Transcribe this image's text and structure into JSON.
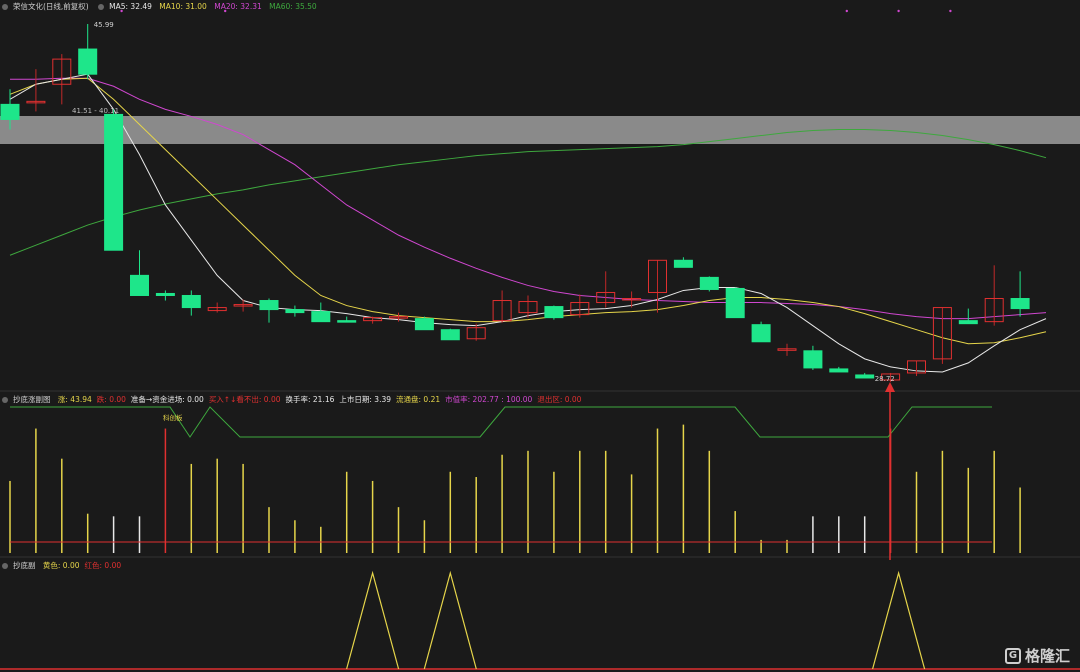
{
  "header": {
    "stock": "荣信文化(日线,前复权)",
    "ma5": "MA5: 32.49",
    "ma10": "MA10: 31.00",
    "ma20": "MA20: 32.31",
    "ma60": "MA60: 35.50",
    "colors": {
      "ma5": "#e8e8e8",
      "ma10": "#e6d54a",
      "ma20": "#d047d0",
      "ma60": "#3ea83e"
    }
  },
  "annotations": {
    "high": "45.99",
    "low": "28.72",
    "zone": "41.51 - 40.11",
    "board": "科创板"
  },
  "panel2": {
    "title": "抄底涨副图",
    "items": [
      "涨: 43.94",
      "跌: 0.00",
      "准备→资金进场: 0.00",
      "买入↑↓看不出: 0.00",
      "换手率: 21.16",
      "上市日期: 3.39",
      "流通盘: 0.21",
      "市值率: 202.77 : 100.00",
      "退出区: 0.00"
    ],
    "colors": [
      "#e6d54a",
      "#e03030",
      "#e8e8e8",
      "#e03030",
      "#e8e8e8",
      "#e8e8e8",
      "#e6d54a",
      "#d047d0",
      "#e03030"
    ]
  },
  "panel3": {
    "title": "抄底副",
    "items": [
      "黄色: 0.00",
      "红色: 0.00"
    ],
    "colors": [
      "#e6d54a",
      "#e03030"
    ]
  },
  "watermark": "格隆汇",
  "chart_data": {
    "type": "candlestick",
    "candles": [
      {
        "o": 38.0,
        "h": 39.5,
        "l": 35.5,
        "c": 36.5
      },
      {
        "o": 38.2,
        "h": 41.5,
        "l": 37.3,
        "c": 38.3
      },
      {
        "o": 40.0,
        "h": 43.0,
        "l": 38.0,
        "c": 42.5
      },
      {
        "o": 43.5,
        "h": 45.99,
        "l": 40.5,
        "c": 41.0
      },
      {
        "o": 37.0,
        "h": 37.5,
        "l": 23.5,
        "c": 23.5
      },
      {
        "o": 21.0,
        "h": 23.5,
        "l": 19.5,
        "c": 19.0
      },
      {
        "o": 19.2,
        "h": 19.5,
        "l": 18.5,
        "c": 19.0
      },
      {
        "o": 19.0,
        "h": 19.5,
        "l": 17.0,
        "c": 17.8
      },
      {
        "o": 17.5,
        "h": 18.3,
        "l": 17.3,
        "c": 17.8
      },
      {
        "o": 18.0,
        "h": 18.6,
        "l": 17.4,
        "c": 18.1
      },
      {
        "o": 18.5,
        "h": 18.7,
        "l": 16.3,
        "c": 17.6
      },
      {
        "o": 17.6,
        "h": 18.0,
        "l": 16.9,
        "c": 17.3
      },
      {
        "o": 17.4,
        "h": 18.3,
        "l": 16.4,
        "c": 16.4
      },
      {
        "o": 16.5,
        "h": 16.9,
        "l": 16.4,
        "c": 16.4
      },
      {
        "o": 16.5,
        "h": 16.9,
        "l": 16.2,
        "c": 16.8
      },
      {
        "o": 16.9,
        "h": 17.3,
        "l": 16.4,
        "c": 16.9
      },
      {
        "o": 16.7,
        "h": 16.9,
        "l": 15.8,
        "c": 15.6
      },
      {
        "o": 15.6,
        "h": 15.7,
        "l": 14.6,
        "c": 14.6
      },
      {
        "o": 14.7,
        "h": 16.2,
        "l": 14.5,
        "c": 15.8
      },
      {
        "o": 16.5,
        "h": 19.5,
        "l": 16.3,
        "c": 18.5
      },
      {
        "o": 17.3,
        "h": 19.0,
        "l": 16.8,
        "c": 18.4
      },
      {
        "o": 17.9,
        "h": 18.0,
        "l": 16.6,
        "c": 16.8
      },
      {
        "o": 17.1,
        "h": 19.1,
        "l": 16.8,
        "c": 18.3
      },
      {
        "o": 18.3,
        "h": 21.4,
        "l": 17.8,
        "c": 19.3
      },
      {
        "o": 18.6,
        "h": 19.4,
        "l": 17.8,
        "c": 18.7
      },
      {
        "o": 19.3,
        "h": 22.5,
        "l": 17.3,
        "c": 22.5
      },
      {
        "o": 22.5,
        "h": 22.8,
        "l": 21.8,
        "c": 21.8
      },
      {
        "o": 20.8,
        "h": 20.9,
        "l": 19.4,
        "c": 19.6
      },
      {
        "o": 19.7,
        "h": 19.8,
        "l": 16.8,
        "c": 16.8
      },
      {
        "o": 16.1,
        "h": 16.4,
        "l": 14.5,
        "c": 14.4
      },
      {
        "o": 13.7,
        "h": 14.2,
        "l": 13.0,
        "c": 13.7
      },
      {
        "o": 13.5,
        "h": 14.0,
        "l": 11.6,
        "c": 11.8
      },
      {
        "o": 11.7,
        "h": 11.9,
        "l": 11.4,
        "c": 11.4
      },
      {
        "o": 11.1,
        "h": 11.3,
        "l": 10.8,
        "c": 10.8
      },
      {
        "o": 10.6,
        "h": 11.3,
        "l": 10.4,
        "c": 11.2
      },
      {
        "o": 11.3,
        "h": 12.5,
        "l": 11.0,
        "c": 12.5
      },
      {
        "o": 12.7,
        "h": 17.8,
        "l": 12.2,
        "c": 17.8
      },
      {
        "o": 16.5,
        "h": 17.7,
        "l": 16.2,
        "c": 16.2
      },
      {
        "o": 16.4,
        "h": 22.0,
        "l": 16.0,
        "c": 18.7
      },
      {
        "o": 18.7,
        "h": 21.4,
        "l": 16.9,
        "c": 17.7
      }
    ],
    "price_levels": {
      "high": 45.99,
      "low": 28.72,
      "zone": [
        41.51,
        40.11
      ]
    },
    "ma5": [
      38.5,
      40,
      40.5,
      41,
      37.5,
      33,
      28,
      24.5,
      21,
      18.5,
      17.8,
      17.6,
      17.5,
      17.2,
      16.8,
      16.6,
      16.3,
      16.1,
      16,
      16.4,
      17,
      17.4,
      17.6,
      17.7,
      18,
      18.6,
      19.5,
      19.8,
      19.8,
      19.2,
      17.8,
      16,
      14.2,
      12.7,
      11.9,
      11.5,
      11.4,
      12.3,
      14,
      15.6,
      16.7
    ],
    "ma10": [
      39,
      40,
      40.5,
      40.6,
      38.5,
      36,
      33.5,
      31,
      28.5,
      26,
      23.5,
      21,
      19,
      18,
      17.4,
      17,
      16.8,
      16.6,
      16.4,
      16.4,
      16.6,
      16.9,
      17.1,
      17.3,
      17.4,
      17.6,
      18,
      18.5,
      18.8,
      18.8,
      18.6,
      18.3,
      17.9,
      17.2,
      16.4,
      15.6,
      14.8,
      14.2,
      14.3,
      14.8,
      15.4
    ],
    "ma20": [
      40.5,
      40.5,
      40.6,
      40.6,
      39.8,
      38.5,
      37.5,
      36.8,
      36,
      35,
      33.5,
      32,
      30,
      28,
      26.5,
      25,
      23.8,
      22.7,
      21.7,
      20.8,
      20,
      19.4,
      19,
      18.8,
      18.6,
      18.5,
      18.4,
      18.3,
      18.3,
      18.3,
      18.2,
      18.1,
      17.9,
      17.6,
      17.2,
      16.9,
      16.7,
      16.7,
      16.9,
      17.1,
      17.3
    ],
    "ma60": [
      23,
      24,
      25,
      26,
      26.8,
      27.5,
      28.1,
      28.6,
      29.1,
      29.5,
      30,
      30.4,
      30.8,
      31.2,
      31.6,
      32,
      32.3,
      32.6,
      32.9,
      33.1,
      33.3,
      33.4,
      33.5,
      33.6,
      33.7,
      33.8,
      34,
      34.3,
      34.6,
      34.9,
      35.2,
      35.4,
      35.5,
      35.5,
      35.4,
      35.2,
      34.9,
      34.5,
      34,
      33.4,
      32.7
    ],
    "panel2_bars": [
      0.55,
      0.95,
      0.72,
      0.3,
      0.28,
      0.28,
      0.95,
      0.68,
      0.72,
      0.68,
      0.35,
      0.25,
      0.2,
      0.62,
      0.55,
      0.35,
      0.25,
      0.62,
      0.58,
      0.75,
      0.78,
      0.62,
      0.78,
      0.78,
      0.6,
      0.95,
      0.98,
      0.78,
      0.32,
      0.1,
      0.1,
      0.28,
      0.28,
      0.28,
      0.95,
      0.62,
      0.78,
      0.65,
      0.78,
      0.5
    ],
    "panel2_bar_colors": [
      "y",
      "y",
      "y",
      "y",
      "w",
      "w",
      "r",
      "y",
      "y",
      "y",
      "y",
      "y",
      "y",
      "y",
      "y",
      "y",
      "y",
      "y",
      "y",
      "y",
      "y",
      "y",
      "y",
      "y",
      "y",
      "y",
      "y",
      "y",
      "y",
      "y",
      "y",
      "w",
      "w",
      "w",
      "r",
      "y",
      "y",
      "y",
      "y",
      "y"
    ],
    "panel3_peaks": [
      14,
      17,
      34
    ]
  }
}
